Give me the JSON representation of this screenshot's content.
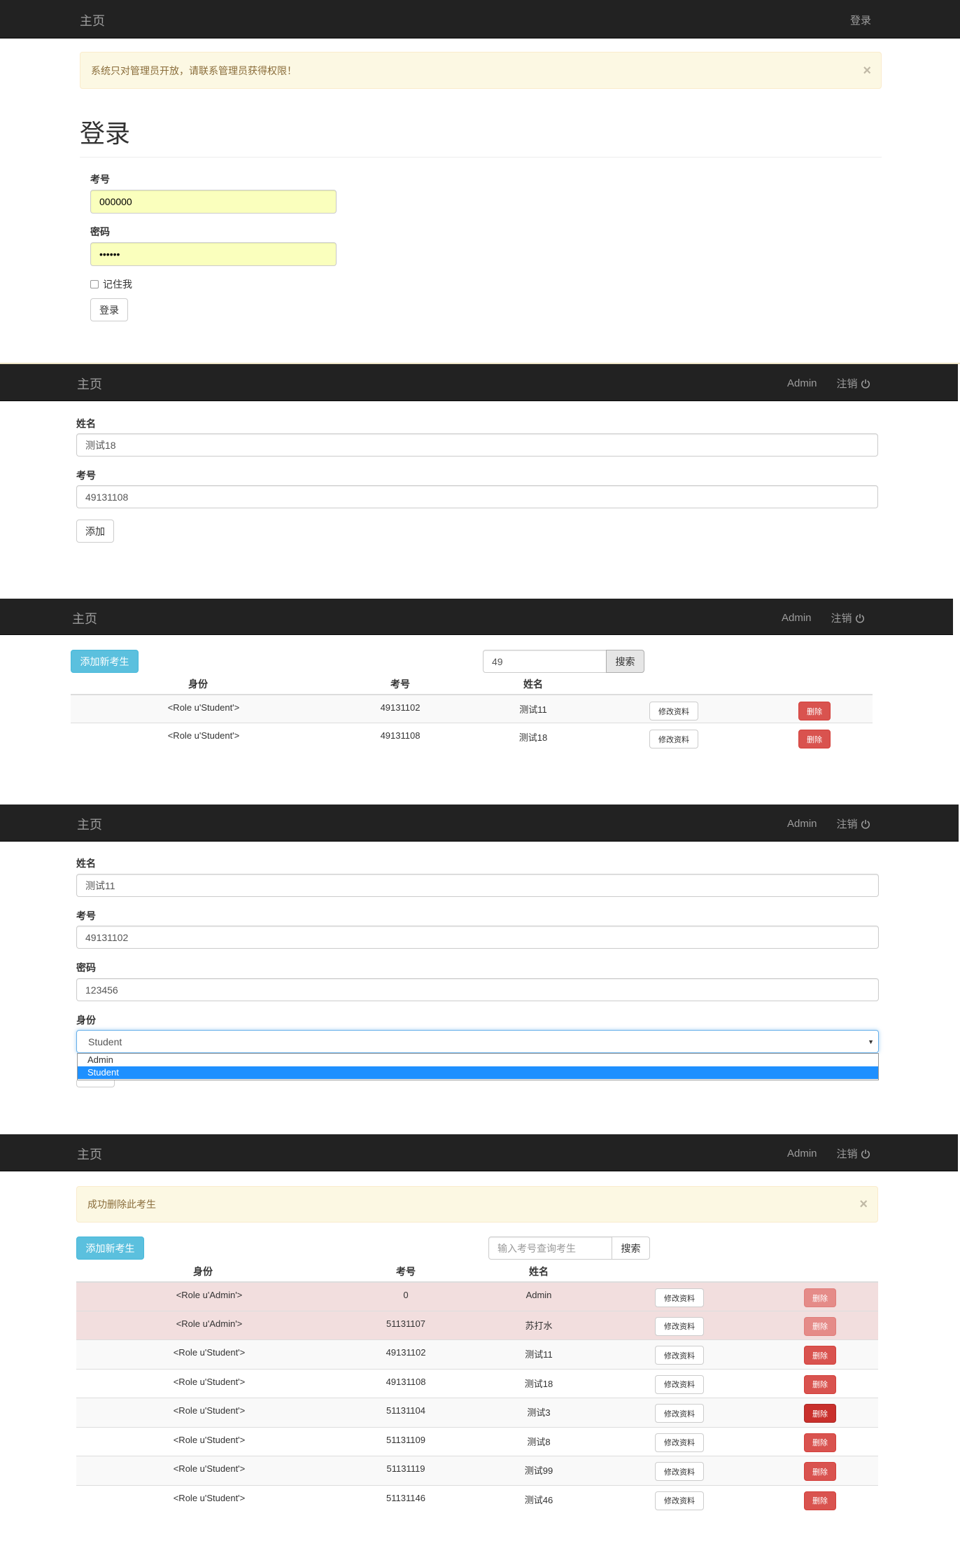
{
  "brand": "主页",
  "panel1": {
    "nav_right": "登录",
    "alert": "系统只对管理员开放，请联系管理员获得权限！",
    "alert_close": "×",
    "title": "登录",
    "id_label": "考号",
    "id_value": "000000",
    "pwd_label": "密码",
    "pwd_value": "••••••",
    "remember_label": "记住我",
    "submit_label": "登录"
  },
  "panel2": {
    "user": "Admin",
    "logout": "注销",
    "name_label": "姓名",
    "name_value": "测试18",
    "id_label": "考号",
    "id_value": "49131108",
    "add_label": "添加"
  },
  "panel3": {
    "user": "Admin",
    "logout": "注销",
    "add_new_label": "添加新考生",
    "search_value": "49",
    "search_label": "搜索",
    "headers": [
      "身份",
      "考号",
      "姓名"
    ],
    "rows": [
      {
        "role": "<Role u'Student'>",
        "id": "49131102",
        "name": "测试11",
        "edit": "修改资料",
        "delete": "删除"
      },
      {
        "role": "<Role u'Student'>",
        "id": "49131108",
        "name": "测试18",
        "edit": "修改资料",
        "delete": "删除"
      }
    ]
  },
  "panel4": {
    "user": "Admin",
    "logout": "注销",
    "name_label": "姓名",
    "name_value": "测试11",
    "id_label": "考号",
    "id_value": "49131102",
    "pwd_label": "密码",
    "pwd_value": "123456",
    "role_label": "身份",
    "role_value": "Student",
    "role_options": [
      "Admin",
      "Student"
    ]
  },
  "panel5": {
    "user": "Admin",
    "logout": "注销",
    "alert": "成功删除此考生",
    "alert_close": "×",
    "add_new_label": "添加新考生",
    "search_placeholder": "输入考号查询考生",
    "search_label": "搜索",
    "headers": [
      "身份",
      "考号",
      "姓名"
    ],
    "rows": [
      {
        "role": "<Role u'Admin'>",
        "id": "0",
        "name": "Admin",
        "edit": "修改资料",
        "delete": "删除"
      },
      {
        "role": "<Role u'Admin'>",
        "id": "51131107",
        "name": "苏打水",
        "edit": "修改资料",
        "delete": "删除"
      },
      {
        "role": "<Role u'Student'>",
        "id": "49131102",
        "name": "测试11",
        "edit": "修改资料",
        "delete": "删除"
      },
      {
        "role": "<Role u'Student'>",
        "id": "49131108",
        "name": "测试18",
        "edit": "修改资料",
        "delete": "删除"
      },
      {
        "role": "<Role u'Student'>",
        "id": "51131104",
        "name": "测试3",
        "edit": "修改资料",
        "delete": "删除"
      },
      {
        "role": "<Role u'Student'>",
        "id": "51131109",
        "name": "测试8",
        "edit": "修改资料",
        "delete": "删除"
      },
      {
        "role": "<Role u'Student'>",
        "id": "51131119",
        "name": "测试99",
        "edit": "修改资料",
        "delete": "删除"
      },
      {
        "role": "<Role u'Student'>",
        "id": "51131146",
        "name": "测试46",
        "edit": "修改资料",
        "delete": "删除"
      }
    ]
  }
}
